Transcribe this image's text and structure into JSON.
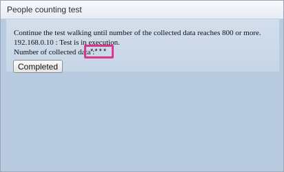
{
  "dialog": {
    "title": "People counting test",
    "instruction": "Continue the test walking until number of the collected data reaches 800 or more.",
    "status": "192.168.0.10 : Test is in execution.",
    "count_label": "Number of collected data :",
    "count_value": "****",
    "completed_label": "Completed",
    "highlight_color": "#e0338f"
  }
}
